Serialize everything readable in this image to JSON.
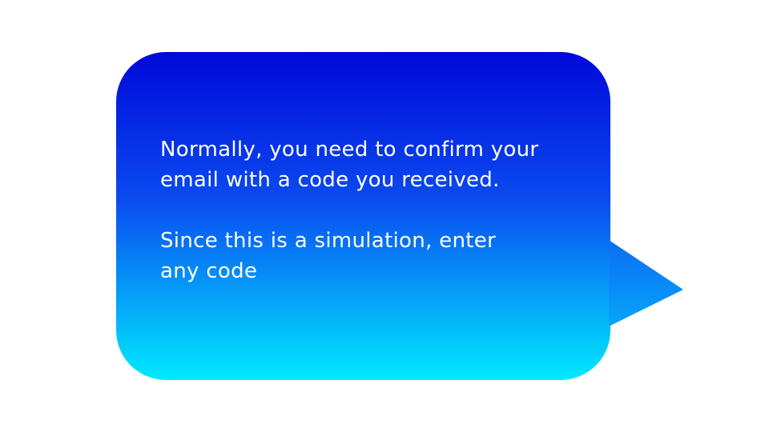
{
  "callout": {
    "paragraph_1_line_1": "Normally, you need to confirm your",
    "paragraph_1_line_2": "email with a code you received.",
    "paragraph_2_line_1": "Since this is a simulation, enter",
    "paragraph_2_line_2": "any code"
  },
  "colors": {
    "gradient_top": "#0008d8",
    "gradient_bottom": "#00eaff",
    "text": "#ffffff",
    "background": "#ffffff"
  }
}
